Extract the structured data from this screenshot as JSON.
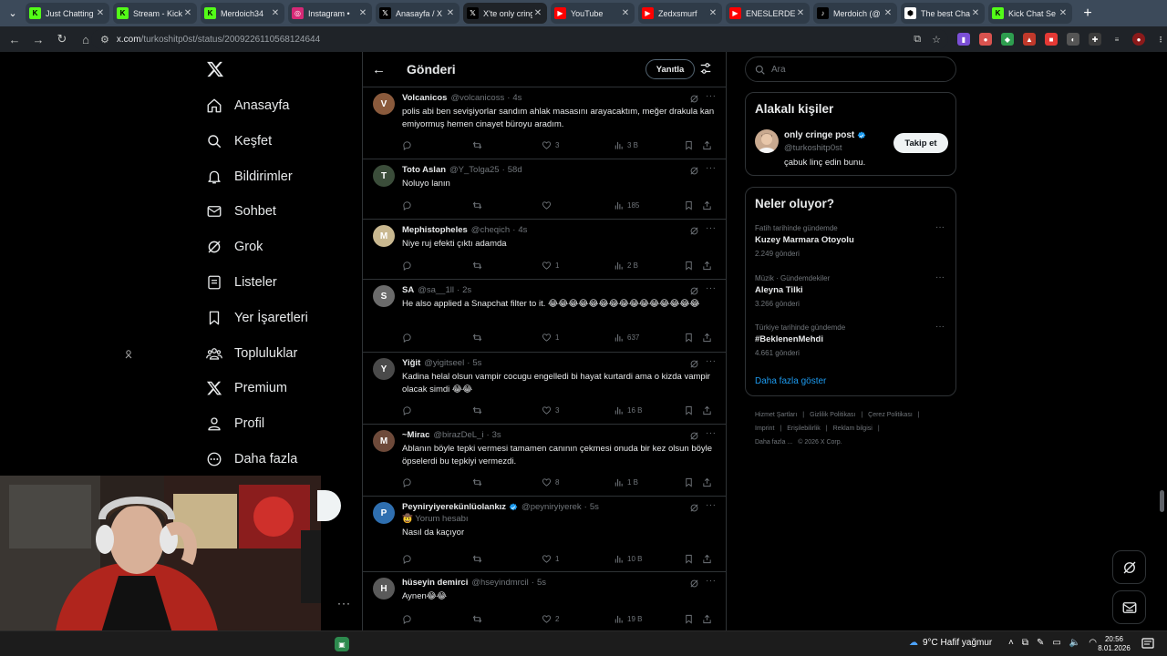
{
  "browser": {
    "tabs": [
      {
        "title": "Just Chatting",
        "fav_color": "#53fc18",
        "fav_glyph": "K",
        "active": false
      },
      {
        "title": "Stream - Kick",
        "fav_color": "#53fc18",
        "fav_glyph": "K",
        "active": false
      },
      {
        "title": "Merdoich34",
        "fav_color": "#53fc18",
        "fav_glyph": "K",
        "active": false
      },
      {
        "title": "Instagram •",
        "fav_color": "#d62976",
        "fav_glyph": "◎",
        "active": false
      },
      {
        "title": "Anasayfa / X",
        "fav_color": "#000000",
        "fav_glyph": "𝕏",
        "active": false
      },
      {
        "title": "X'te only cringe",
        "fav_color": "#000000",
        "fav_glyph": "𝕏",
        "active": true
      },
      {
        "title": "YouTube",
        "fav_color": "#ff0000",
        "fav_glyph": "▶",
        "active": false
      },
      {
        "title": "Zedxsmurf",
        "fav_color": "#ff0000",
        "fav_glyph": "▶",
        "active": false
      },
      {
        "title": "ENESLERDEN",
        "fav_color": "#ff0000",
        "fav_glyph": "▶",
        "active": false
      },
      {
        "title": "Merdoich (@",
        "fav_color": "#000000",
        "fav_glyph": "♪",
        "active": false
      },
      {
        "title": "The best Chat",
        "fav_color": "#ffffff",
        "fav_glyph": "⬢",
        "active": false
      },
      {
        "title": "Kick Chat Se",
        "fav_color": "#53fc18",
        "fav_glyph": "K",
        "active": false
      }
    ],
    "url_domain": "x.com",
    "url_path": "/turkoshitp0st/status/2009226110568124644"
  },
  "nav": {
    "items": [
      {
        "label": "Anasayfa",
        "icon": "home-icon"
      },
      {
        "label": "Keşfet",
        "icon": "search-icon"
      },
      {
        "label": "Bildirimler",
        "icon": "bell-icon"
      },
      {
        "label": "Sohbet",
        "icon": "mail-icon"
      },
      {
        "label": "Grok",
        "icon": "grok-icon"
      },
      {
        "label": "Listeler",
        "icon": "list-icon"
      },
      {
        "label": "Yer İşaretleri",
        "icon": "bookmark-icon"
      },
      {
        "label": "Topluluklar",
        "icon": "communities-icon"
      },
      {
        "label": "Premium",
        "icon": "x-premium-icon"
      },
      {
        "label": "Profil",
        "icon": "person-icon"
      },
      {
        "label": "Daha fazla",
        "icon": "more-circle-icon"
      }
    ]
  },
  "header": {
    "title": "Gönderi",
    "reply_label": "Yanıtla"
  },
  "tweets": [
    {
      "name": "Volcanicos",
      "handle": "@volcanicoss",
      "time": "4s",
      "verified": false,
      "text": "polis abi ben sevişiyorlar sandım ahlak masasını arayacaktım, meğer drakula kan emiyormuş hemen cinayet büroyu aradım.",
      "likes": "3",
      "views": "3 B",
      "avatar_color": "#8a5a3c",
      "avatar_glyph": "V"
    },
    {
      "name": "Toto Aslan",
      "handle": "@Y_Tolga25",
      "time": "58d",
      "verified": false,
      "text": "Noluyo lanın",
      "likes": "",
      "views": "185",
      "avatar_color": "#3b4d3a",
      "avatar_glyph": "T"
    },
    {
      "name": "Mephistopheles",
      "handle": "@cheqich",
      "time": "4s",
      "verified": false,
      "text": "Niye ruj efekti çıktı adamda",
      "likes": "1",
      "views": "2 B",
      "avatar_color": "#c9b890",
      "avatar_glyph": "M"
    },
    {
      "name": "SA",
      "handle": "@sa__1ll",
      "time": "2s",
      "verified": false,
      "text": "He also applied a Snapchat filter to it. 😂😂😂😂😂😂😂😂😂😂😂😂😂😂😂",
      "likes": "1",
      "views": "637",
      "avatar_color": "#6b6b6b",
      "avatar_glyph": "S"
    },
    {
      "name": "Yiğit",
      "handle": "@yigitseel",
      "time": "5s",
      "verified": false,
      "text": "Kadina helal olsun vampir cocugu engelledi bi hayat kurtardi ama o kizda vampir olacak simdi 😂😂",
      "likes": "3",
      "views": "16 B",
      "avatar_color": "#4a4a4a",
      "avatar_glyph": "Y"
    },
    {
      "name": "~Mirac",
      "handle": "@birazDeL_i",
      "time": "3s",
      "verified": false,
      "text": "Ablanın böyle tepki vermesi tamamen canının çekmesi onuda bir kez olsun böyle öpselerdi  bu tepkiyi  vermezdi.",
      "likes": "8",
      "views": "1 B",
      "avatar_color": "#6e4a3a",
      "avatar_glyph": "M"
    },
    {
      "name": "Peyniryiyerekünlüolankız",
      "handle": "@peyniryiyerek",
      "time": "5s",
      "verified": true,
      "sub": "🤠 Yorum hesabı",
      "text": "Nasıl da kaçıyor",
      "likes": "1",
      "views": "10 B",
      "avatar_color": "#2f6fb0",
      "avatar_glyph": "P"
    },
    {
      "name": "hüseyin demirci",
      "handle": "@hseyindmrcil",
      "time": "5s",
      "verified": false,
      "text": "Aynen😂😂",
      "likes": "2",
      "views": "19 B",
      "avatar_color": "#5a5a5a",
      "avatar_glyph": "H"
    }
  ],
  "search": {
    "placeholder": "Ara"
  },
  "related": {
    "title": "Alakalı kişiler",
    "name": "only cringe post",
    "handle": "@turkoshitp0st",
    "bio": "çabuk linç edin bunu.",
    "follow_label": "Takip et"
  },
  "trends": {
    "title": "Neler oluyor?",
    "items": [
      {
        "category": "Fatih tarihinde gündemde",
        "name": "Kuzey Marmara Otoyolu",
        "count": "2.249 gönderi"
      },
      {
        "category": "Müzik · Gündemdekiler",
        "name": "Aleyna Tilki",
        "count": "3.266 gönderi"
      },
      {
        "category": "Türkiye tarihinde gündemde",
        "name": "#BeklenenMehdi",
        "count": "4.661 gönderi"
      }
    ],
    "show_more": "Daha fazla göster"
  },
  "footer": {
    "links": [
      "Hizmet Şartları",
      "|",
      "Gizlilik Politikası",
      "|",
      "Çerez Politikası",
      "|",
      "Imprint",
      "|",
      "Erişilebilirlik",
      "|",
      "Reklam bilgisi",
      "|",
      "Daha fazla ...",
      "© 2026 X Corp."
    ]
  },
  "taskbar": {
    "weather": "9°C  Hafif yağmur",
    "time": "20:56",
    "date": "8.01.2026"
  },
  "colors": {
    "accent": "#1d9bf0",
    "background": "#000000",
    "border": "#2f3336",
    "muted": "#71767b"
  }
}
